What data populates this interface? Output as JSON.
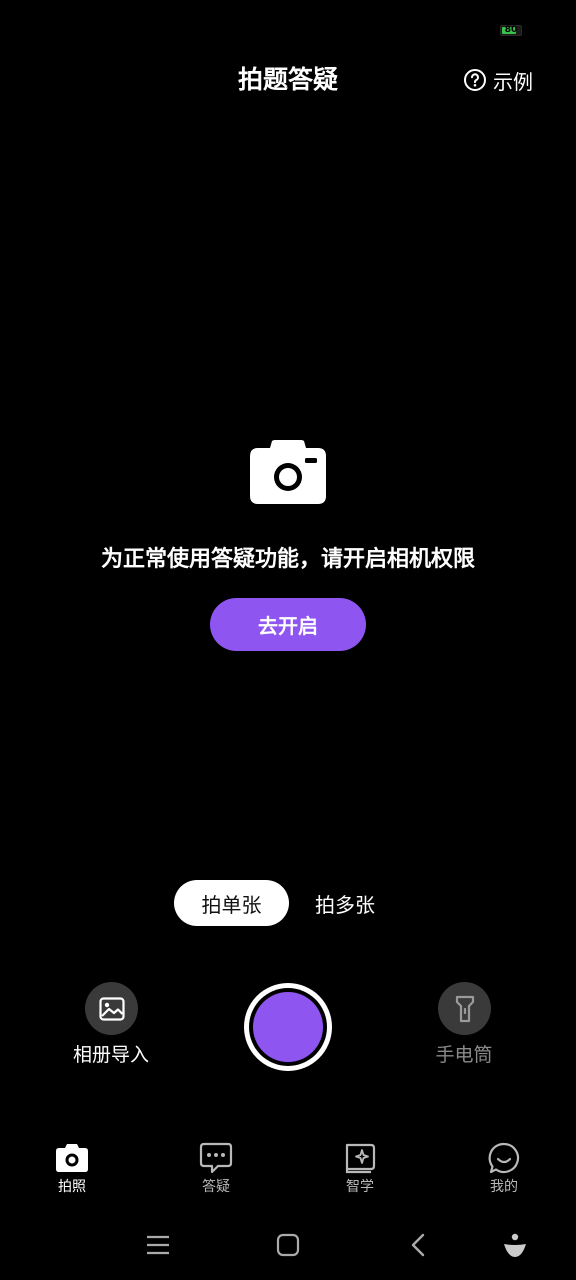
{
  "status_bar": {
    "battery": "80",
    "battery_level": 0.8
  },
  "header": {
    "title": "拍题答疑",
    "example_label": "示例"
  },
  "permission": {
    "message": "为正常使用答疑功能，请开启相机权限",
    "button_label": "去开启"
  },
  "mode_switch": {
    "single_label": "拍单张",
    "multi_label": "拍多张",
    "selected": "single"
  },
  "controls": {
    "album_label": "相册导入",
    "torch_label": "手电筒"
  },
  "tabs": [
    {
      "label": "拍照",
      "icon": "camera-icon",
      "active": true
    },
    {
      "label": "答疑",
      "icon": "chat-bubble-icon",
      "active": false
    },
    {
      "label": "智学",
      "icon": "book-sparkle-icon",
      "active": false
    },
    {
      "label": "我的",
      "icon": "smile-face-icon",
      "active": false
    }
  ],
  "colors": {
    "accent": "#8f55f1",
    "background": "#000000",
    "battery_green": "#38c24a"
  }
}
